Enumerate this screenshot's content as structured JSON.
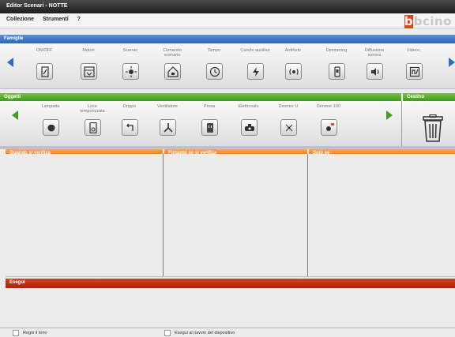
{
  "window": {
    "title": "Editor Scenari - NOTTE"
  },
  "menu": {
    "items": [
      "Collezione",
      "Strumenti",
      "?"
    ]
  },
  "brand": {
    "first_letter": "b",
    "rest": "bcino"
  },
  "famiglie": {
    "header": "Famiglie",
    "items": [
      {
        "label": "ON/OFF",
        "icon": "on-off-icon"
      },
      {
        "label": "Motori",
        "icon": "motor-icon"
      },
      {
        "label": "Scenari",
        "icon": "scenario-icon"
      },
      {
        "label": "Comando\nscenario",
        "icon": "scenario-command-icon"
      },
      {
        "label": "Tempo",
        "icon": "clock-icon"
      },
      {
        "label": "Carichi ausiliari",
        "icon": "auxiliary-load-icon"
      },
      {
        "label": "Antifurto",
        "icon": "alarm-icon"
      },
      {
        "label": "Dimmering",
        "icon": "dimmer-icon"
      },
      {
        "label": "Diffusione\nsonora",
        "icon": "speaker-icon"
      },
      {
        "label": "Videoc.",
        "icon": "video-icon"
      }
    ]
  },
  "oggetti": {
    "header": "Oggetti",
    "items": [
      {
        "label": "Lampada",
        "icon": "lamp-icon"
      },
      {
        "label": "Luce\ntemporizzata",
        "icon": "timed-light-icon"
      },
      {
        "label": "Dripps",
        "icon": "dripps-icon"
      },
      {
        "label": "Ventilatore",
        "icon": "fan-icon"
      },
      {
        "label": "Presa",
        "icon": "socket-icon"
      },
      {
        "label": "Elettrovalv.",
        "icon": "valve-icon"
      },
      {
        "label": "Dimmer U",
        "icon": "dimmer-u-icon"
      },
      {
        "label": "Dimmer 100",
        "icon": "dimmer-100-icon"
      }
    ]
  },
  "cestino": {
    "header": "Cestino"
  },
  "panels": {
    "quando": "Quando si verifica",
    "finche": "Fintanto se si verifica",
    "solo": "Solo se"
  },
  "esegui": {
    "header": "Esegui"
  },
  "checkboxes": {
    "first": "Regni il tono",
    "second": "Esegui al riavvio del dispositivo"
  }
}
